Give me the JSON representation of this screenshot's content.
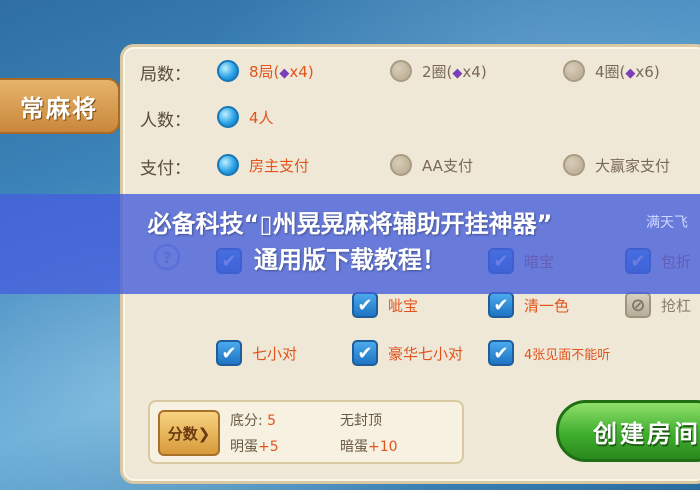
{
  "tab": {
    "label": "常麻将"
  },
  "rows": {
    "rounds": {
      "label": "局数：",
      "options": [
        {
          "text": "8局(",
          "gem": "◆",
          "suffix": "x4)",
          "selected": true
        },
        {
          "text": "2圈(",
          "gem": "◆",
          "suffix": "x4)",
          "selected": false
        },
        {
          "text": "4圈(",
          "gem": "◆",
          "suffix": "x6)",
          "selected": false
        }
      ]
    },
    "players": {
      "label": "人数：",
      "options": [
        {
          "text": "4人",
          "selected": true
        }
      ]
    },
    "payment": {
      "label": "支付：",
      "options": [
        {
          "text": "房主支付",
          "selected": true
        },
        {
          "text": "AA支付",
          "selected": false
        },
        {
          "text": "大赢家支付",
          "selected": false
        }
      ]
    }
  },
  "rules": {
    "peek": [
      "满天飞",
      "暗宝",
      "包折"
    ],
    "row2": [
      {
        "text": "呲宝",
        "checked": true
      },
      {
        "text": "清一色",
        "checked": true
      },
      {
        "text": "抢杠",
        "checked": false
      }
    ],
    "row3": [
      {
        "text": "七小对",
        "checked": true
      },
      {
        "text": "豪华七小对",
        "checked": true
      },
      {
        "text": "4张见面不能听",
        "checked": true
      }
    ]
  },
  "score": {
    "button": "分数❯",
    "base_label": "底分:",
    "base_value": "5",
    "cap_label": "无封顶",
    "ming_label": "明蛋",
    "ming_value": "+5",
    "an_label": "暗蛋",
    "an_value": "+10"
  },
  "create_button": "创建房间",
  "help_icon": "?",
  "banner": {
    "line1": "必备科技“▯州晃晃麻将辅助开挂神器”",
    "line2": "通用版下载教程！"
  },
  "colors": {
    "accent": "#e2541e",
    "selected_radio": "#2aa3e6",
    "banner": "#465fdc",
    "create_button": "#3fae2e"
  }
}
